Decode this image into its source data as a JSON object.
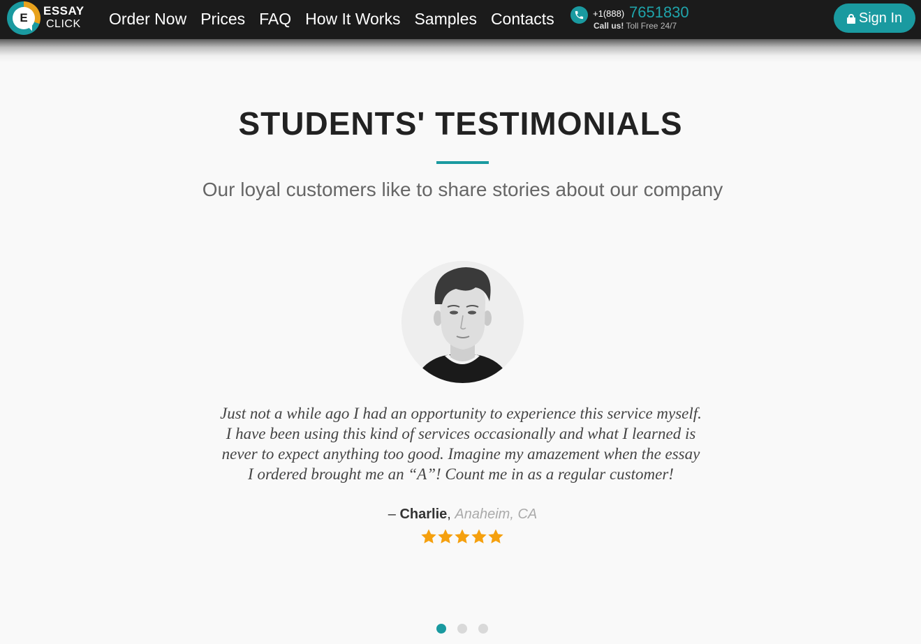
{
  "header": {
    "logo": {
      "line1": "ESSAY",
      "line2": "CLICK",
      "letter": "E"
    },
    "nav": [
      "Order Now",
      "Prices",
      "FAQ",
      "How It Works",
      "Samples",
      "Contacts"
    ],
    "phone": {
      "prefix": "+1(888)",
      "number": "7651830",
      "call_label": "Call us!",
      "toll_free": "Toll Free 24/7",
      "icon": "phone-icon"
    },
    "signin": {
      "label": "Sign In",
      "icon": "lock-icon"
    }
  },
  "testimonials": {
    "title": "STUDENTS' TESTIMONIALS",
    "subtitle": "Our loyal customers like to share stories about our company",
    "quote_lines": [
      "Just not a while ago I had an opportunity to experience this service myself.",
      "I have been using this kind of services occasionally and what I learned is",
      "never to expect anything too good. Imagine my amazement when the essay",
      "I ordered brought me an “A”! Count me in as a regular customer!"
    ],
    "author": {
      "dash": "–",
      "name": "Charlie",
      "separator": ",",
      "location": "Anaheim, CA"
    },
    "rating": 5,
    "slides": 3,
    "active_slide": 1
  },
  "colors": {
    "accent": "#1a9aa0",
    "star": "#f5a00e",
    "header_bg": "#1b1b1b"
  }
}
